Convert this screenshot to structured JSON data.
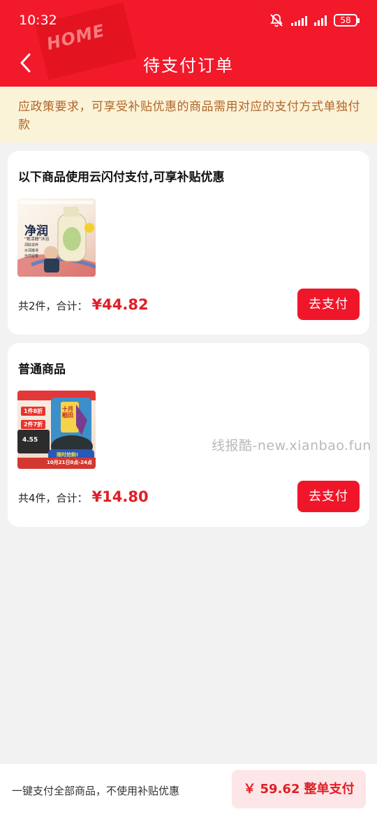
{
  "status_bar": {
    "time": "10:32",
    "battery": "58"
  },
  "header": {
    "stamp_text": "HOME",
    "title": "待支付订单"
  },
  "notice": "应政策要求，可享受补贴优惠的商品需用对应的支付方式单独付款",
  "orders": [
    {
      "title": "以下商品使用云闪付支付,可享补贴优惠",
      "summary": "共2件，合计：",
      "price": "¥44.82",
      "pay_label": "去支付",
      "thumb": {
        "main_text": "净润",
        "sub_text": "\"氧活醇\"沐浴",
        "bullets": [
          "润肤滋养",
          "水润嫩滑",
          "自然留香"
        ]
      }
    },
    {
      "title": "普通商品",
      "summary": "共4件，合计：",
      "price": "¥14.80",
      "pay_label": "去支付",
      "thumb": {
        "promo1": "1件8折",
        "promo2": "2件7折",
        "price_text": "4.55",
        "banner_text": "十月稻田",
        "date_text": "限时抢购!",
        "date_sub": "10月21日0点-24点"
      }
    }
  ],
  "watermark": "线报酷-new.xianbao.fun",
  "bottom": {
    "note": "一键支付全部商品，不使用补贴优惠",
    "total_symbol": "￥",
    "total_amount": "59.62",
    "total_label": "整单支付"
  },
  "colors": {
    "brand_red": "#f2192b",
    "price_red": "#e01e25",
    "notice_bg": "#fbf3d8",
    "notice_text": "#b0652a"
  }
}
